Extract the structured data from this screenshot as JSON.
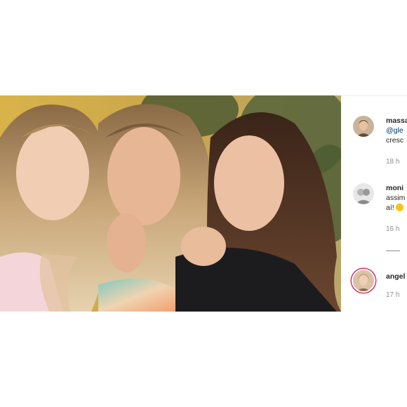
{
  "post": {
    "image_alt": "Three women posing together for a selfie"
  },
  "comments": [
    {
      "username": "massa",
      "mention": "@gle",
      "text": "cresc",
      "time": "18 h"
    },
    {
      "username": "moni",
      "text_line1": "assim",
      "text_line2": "aí!",
      "time": "16 h",
      "emoji": "grinning-face-with-sweat-emoji"
    },
    {
      "username": "angel",
      "time": "17 h"
    }
  ],
  "colors": {
    "username": "#262626",
    "mention": "#00376b",
    "timestamp": "#8e8e8e",
    "story_ring": "#e1306c"
  }
}
